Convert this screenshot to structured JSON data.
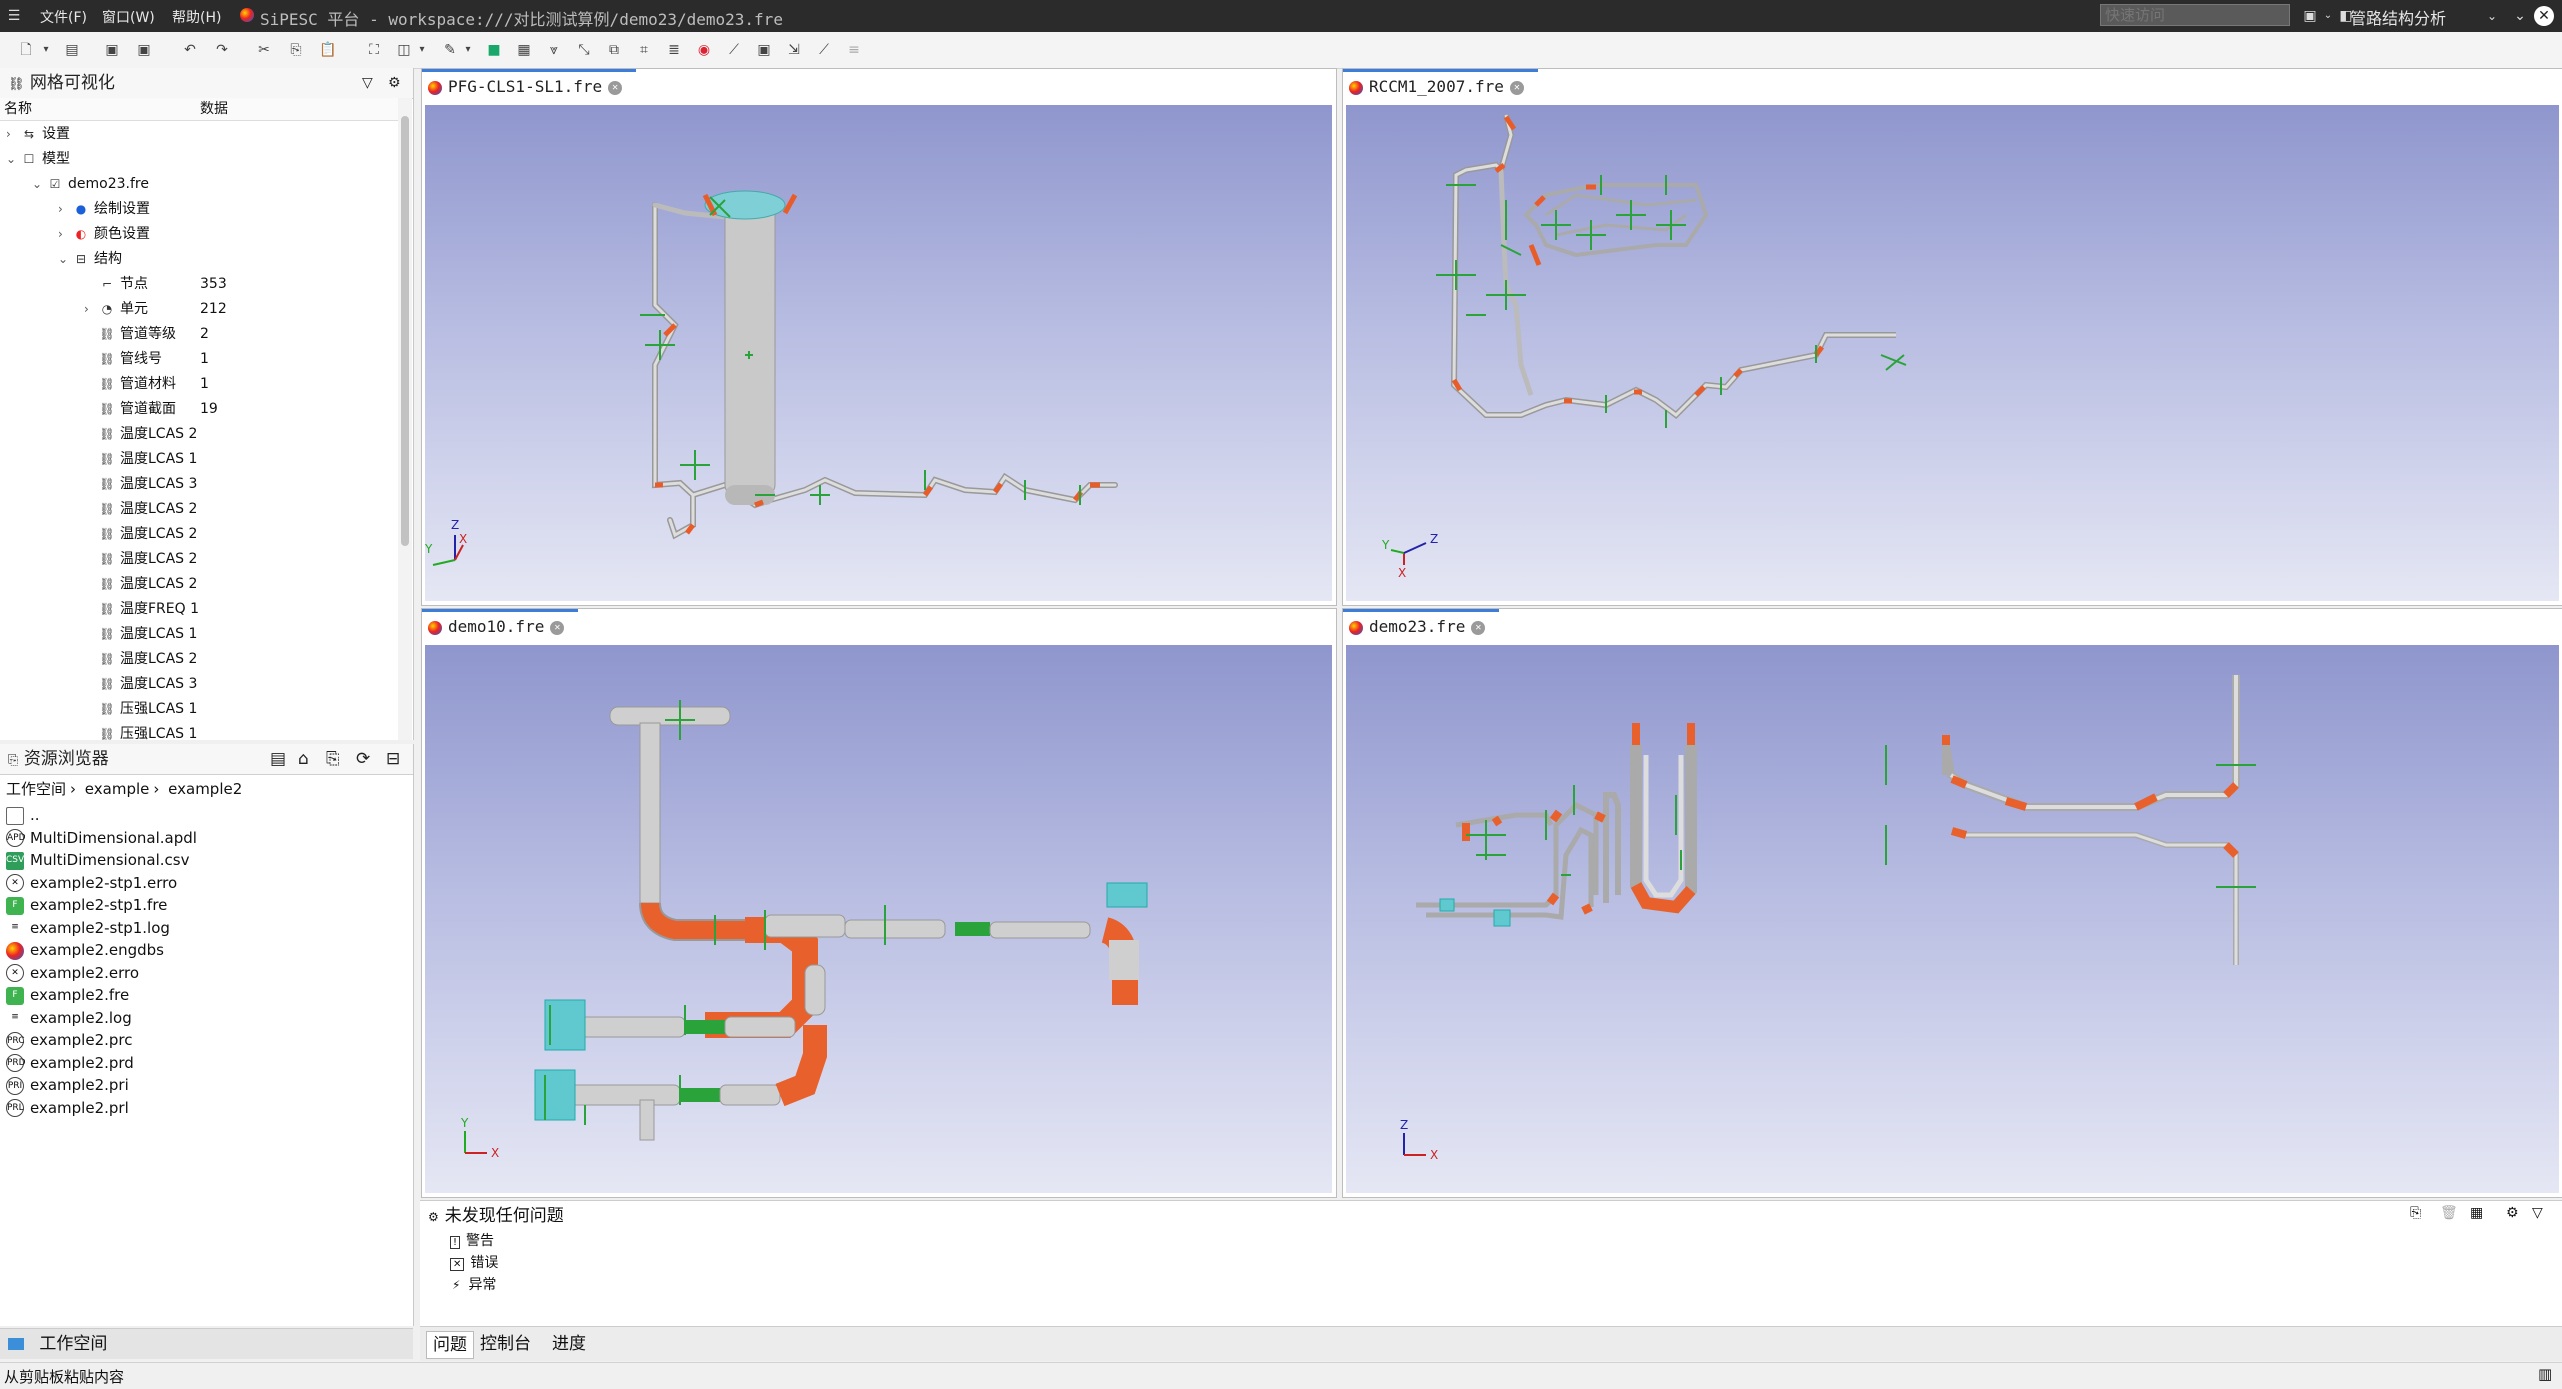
{
  "titlebar": {
    "menu_file": "文件(F)",
    "menu_window": "窗口(W)",
    "menu_help": "帮助(H)",
    "title": "SiPESC 平台 - workspace:///对比测试算例/demo23/demo23.fre",
    "quick_access_placeholder": "快速访问",
    "perspective": "管路结构分析"
  },
  "tree_pane": {
    "title": "网格可视化",
    "col_name": "名称",
    "col_data": "数据",
    "rows": [
      {
        "label": "设置",
        "value": ""
      },
      {
        "label": "模型",
        "value": ""
      },
      {
        "label": "demo23.fre",
        "value": ""
      },
      {
        "label": "绘制设置",
        "value": ""
      },
      {
        "label": "颜色设置",
        "value": ""
      },
      {
        "label": "结构",
        "value": ""
      },
      {
        "label": "节点",
        "value": "353"
      },
      {
        "label": "单元",
        "value": "212"
      },
      {
        "label": "管道等级",
        "value": "2"
      },
      {
        "label": "管线号",
        "value": "1"
      },
      {
        "label": "管道材料",
        "value": "1"
      },
      {
        "label": "管道截面",
        "value": "19"
      },
      {
        "label": "温度LCAS 2",
        "value": ""
      },
      {
        "label": "温度LCAS 1",
        "value": ""
      },
      {
        "label": "温度LCAS 3",
        "value": ""
      },
      {
        "label": "温度LCAS 2",
        "value": ""
      },
      {
        "label": "温度LCAS 2",
        "value": ""
      },
      {
        "label": "温度LCAS 2",
        "value": ""
      },
      {
        "label": "温度LCAS 2",
        "value": ""
      },
      {
        "label": "温度FREQ 1",
        "value": ""
      },
      {
        "label": "温度LCAS 1",
        "value": ""
      },
      {
        "label": "温度LCAS 2",
        "value": ""
      },
      {
        "label": "温度LCAS 3",
        "value": ""
      },
      {
        "label": "压强LCAS 1",
        "value": ""
      },
      {
        "label": "压强LCAS 1",
        "value": ""
      }
    ]
  },
  "resource_pane": {
    "title": "资源浏览器",
    "breadcrumb": [
      "工作空间",
      "example",
      "example2"
    ],
    "files": [
      "..",
      "MultiDimensional.apdl",
      "MultiDimensional.csv",
      "example2-stp1.erro",
      "example2-stp1.fre",
      "example2-stp1.log",
      "example2.engdbs",
      "example2.erro",
      "example2.fre",
      "example2.log",
      "example2.prc",
      "example2.prd",
      "example2.pri",
      "example2.prl"
    ],
    "workspace_label": "工作空间"
  },
  "views": [
    {
      "tab": "PFG-CLS1-SL1.fre"
    },
    {
      "tab": "RCCM1_2007.fre"
    },
    {
      "tab": "demo10.fre"
    },
    {
      "tab": "demo23.fre"
    }
  ],
  "axes": {
    "x": "X",
    "y": "Y",
    "z": "Z"
  },
  "problems": {
    "header": "未发现任何问题",
    "items": [
      "警告",
      "错误",
      "异常"
    ]
  },
  "bottom_tabs": [
    "问题",
    "控制台",
    "进度"
  ],
  "status": "从剪贴板粘贴内容",
  "colors": {
    "accent": "#3b7dd8",
    "pipe": "#c8c8c8",
    "elbow": "#e8602c",
    "support": "#2aa33a",
    "nozzle": "#4fc9d0"
  }
}
